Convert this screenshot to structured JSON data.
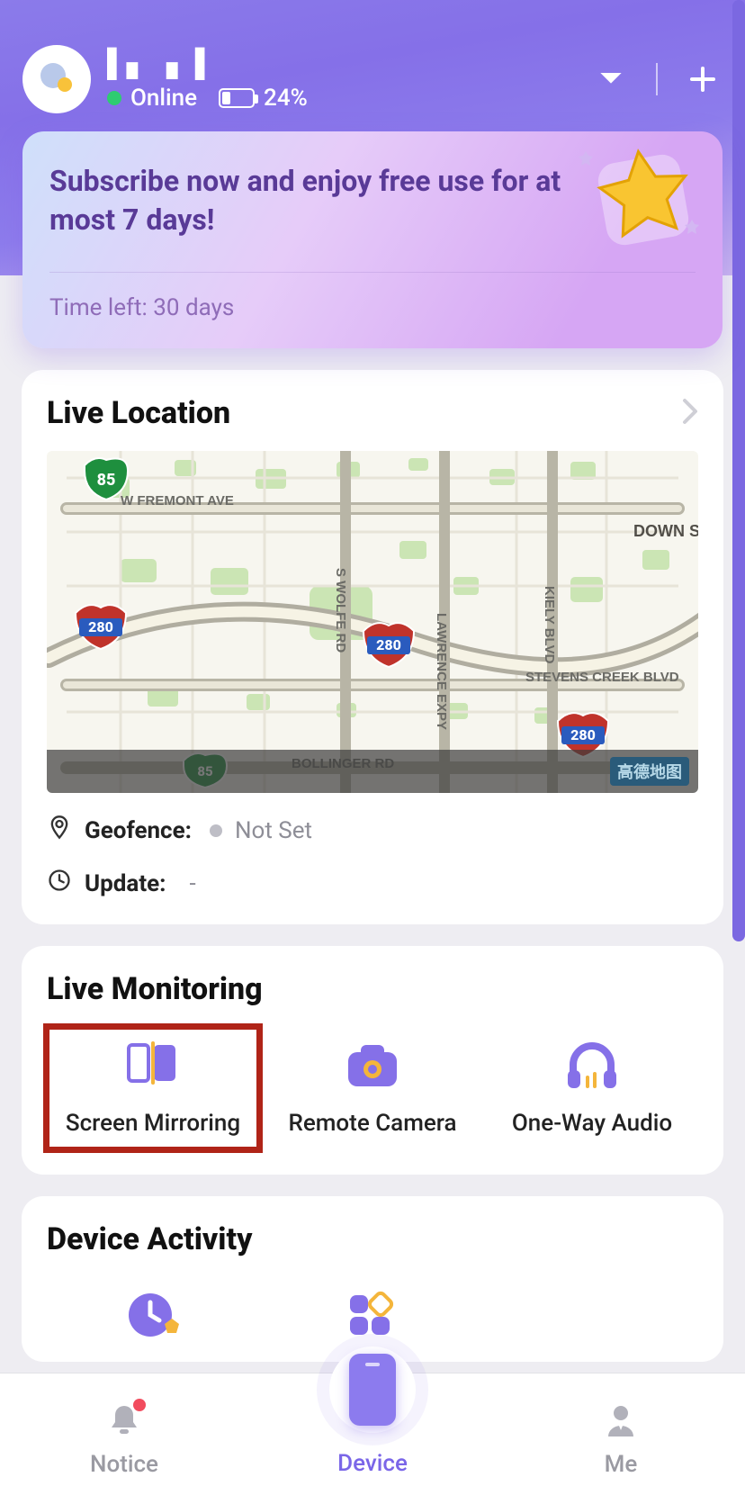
{
  "header": {
    "device_name": "▌▖ ▗ ▐",
    "status_label": "Online",
    "battery_label": "24%"
  },
  "promo": {
    "title": "Subscribe now and enjoy free use for at most 7 days!",
    "subtitle": "Time left: 30 days"
  },
  "live_location": {
    "title": "Live Location",
    "geofence_label": "Geofence:",
    "geofence_value": "Not Set",
    "update_label": "Update:",
    "update_value": "-",
    "map": {
      "highways": [
        "85",
        "280",
        "280",
        "280"
      ],
      "roads": [
        "W FREMONT AVE",
        "S WOLFE RD",
        "LAWRENCE EXPY",
        "KIELY BLVD",
        "STEVENS CREEK BLVD",
        "BOLLINGER RD"
      ],
      "corner_text": "DOWN SANTA",
      "attribution": "高德地图"
    }
  },
  "live_monitoring": {
    "title": "Live Monitoring",
    "items": [
      {
        "label": "Screen Mirroring",
        "icon": "screen-mirroring",
        "highlight": true
      },
      {
        "label": "Remote Camera",
        "icon": "camera",
        "highlight": false
      },
      {
        "label": "One-Way Audio",
        "icon": "headphones",
        "highlight": false
      }
    ]
  },
  "device_activity": {
    "title": "Device Activity"
  },
  "bottom_nav": {
    "notice": "Notice",
    "device": "Device",
    "me": "Me"
  }
}
